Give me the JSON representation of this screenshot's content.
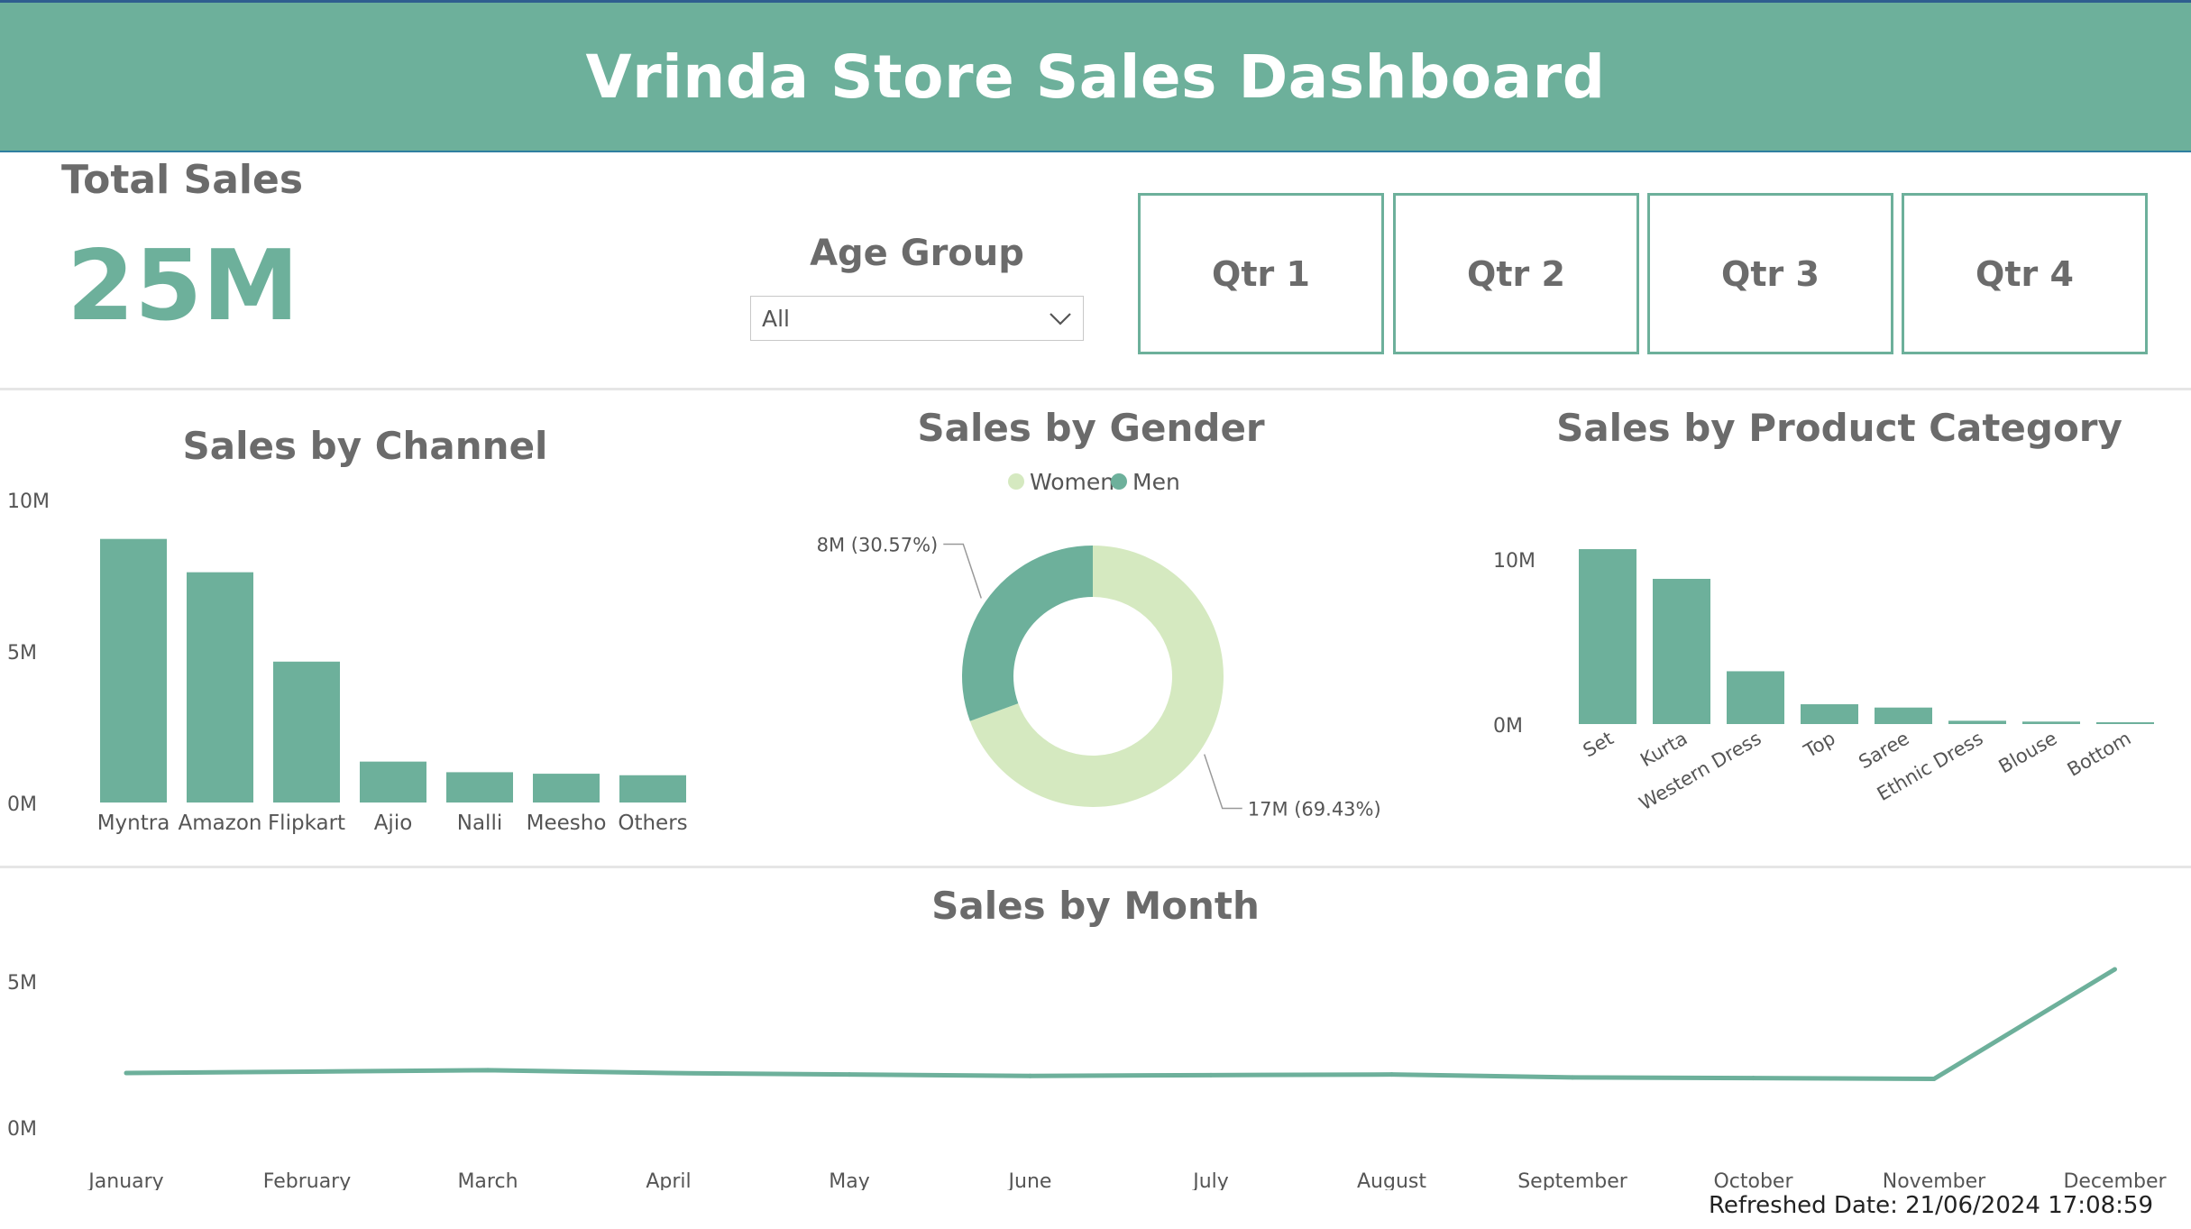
{
  "header": {
    "title": "Vrinda Store Sales Dashboard"
  },
  "kpi": {
    "label": "Total Sales",
    "value": "25M"
  },
  "filter": {
    "label": "Age Group",
    "selected": "All"
  },
  "quarters": [
    "Qtr 1",
    "Qtr 2",
    "Qtr 3",
    "Qtr 4"
  ],
  "colors": {
    "accent": "#6db09b",
    "women": "#d5e9c0",
    "men": "#6db09b"
  },
  "refresh": "Refreshed Date: 21/06/2024 17:08:59",
  "chart_data": [
    {
      "id": "channel",
      "type": "bar",
      "title": "Sales by Channel",
      "categories": [
        "Myntra",
        "Amazon",
        "Flipkart",
        "Ajio",
        "Nalli",
        "Meesho",
        "Others"
      ],
      "values": [
        8.7,
        7.6,
        4.65,
        1.35,
        1.0,
        0.95,
        0.9
      ],
      "ylim": [
        0,
        10
      ],
      "yticks": [
        "0M",
        "5M",
        "10M"
      ],
      "grid": false
    },
    {
      "id": "gender",
      "type": "pie",
      "donut": true,
      "title": "Sales by Gender",
      "legend_position": "top",
      "series": [
        {
          "name": "Women",
          "value": 17,
          "percent": 69.43,
          "label": "17M (69.43%)"
        },
        {
          "name": "Men",
          "value": 8,
          "percent": 30.57,
          "label": "8M (30.57%)"
        }
      ]
    },
    {
      "id": "category",
      "type": "bar",
      "title": "Sales by Product Category",
      "categories": [
        "Set",
        "Kurta",
        "Western Dress",
        "Top",
        "Saree",
        "Ethnic Dress",
        "Blouse",
        "Bottom"
      ],
      "values": [
        10.6,
        8.8,
        3.2,
        1.2,
        1.0,
        0.2,
        0.15,
        0.1
      ],
      "ylim": [
        0,
        10
      ],
      "yticks": [
        "0M",
        "10M"
      ],
      "grid": false
    },
    {
      "id": "month",
      "type": "line",
      "title": "Sales by Month",
      "categories": [
        "January",
        "February",
        "March",
        "April",
        "May",
        "June",
        "July",
        "August",
        "September",
        "October",
        "November",
        "December"
      ],
      "values": [
        1.85,
        1.9,
        1.95,
        1.85,
        1.8,
        1.75,
        1.78,
        1.8,
        1.7,
        1.68,
        1.65,
        5.4
      ],
      "ylim": [
        0,
        5
      ],
      "yticks": [
        "0M",
        "5M"
      ],
      "grid": false
    }
  ]
}
